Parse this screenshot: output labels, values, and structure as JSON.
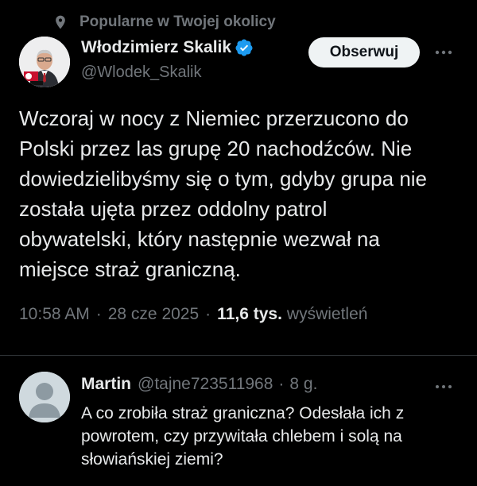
{
  "context": {
    "icon": "location-pin-icon",
    "label": "Popularne w Twojej okolicy"
  },
  "tweet": {
    "author_name": "Włodzimierz Skalik",
    "author_handle": "@Wlodek_Skalik",
    "verified": true,
    "follow_label": "Obserwuj",
    "text": "Wczoraj w nocy z Niemiec przerzucono do\nPolski przez las grupę 20 nachodźców. Nie\ndowiedzielibyśmy się o tym, gdyby grupa nie\nzostała ujęta przez oddolny patrol\nobywatelski, który następnie wezwał na\nmiejsce straż graniczną.",
    "time": "10:58 AM",
    "separator": "·",
    "date": "28 cze 2025",
    "views_count": "11,6 tys.",
    "views_label": "wyświetleń"
  },
  "reply": {
    "author_name": "Martin",
    "author_handle": "@tajne723511968",
    "separator": "·",
    "age": "8 g.",
    "text": "A co zrobiła straż graniczna? Odesłała ich z\npowrotem, czy przywitała chlebem i solą na\nsłowiańskiej ziemi?"
  },
  "colors": {
    "background": "#000000",
    "text": "#e7e9ea",
    "muted": "#71767b",
    "verified": "#1d9bf0",
    "button_bg": "#eff3f4",
    "divider": "#2f3336"
  }
}
